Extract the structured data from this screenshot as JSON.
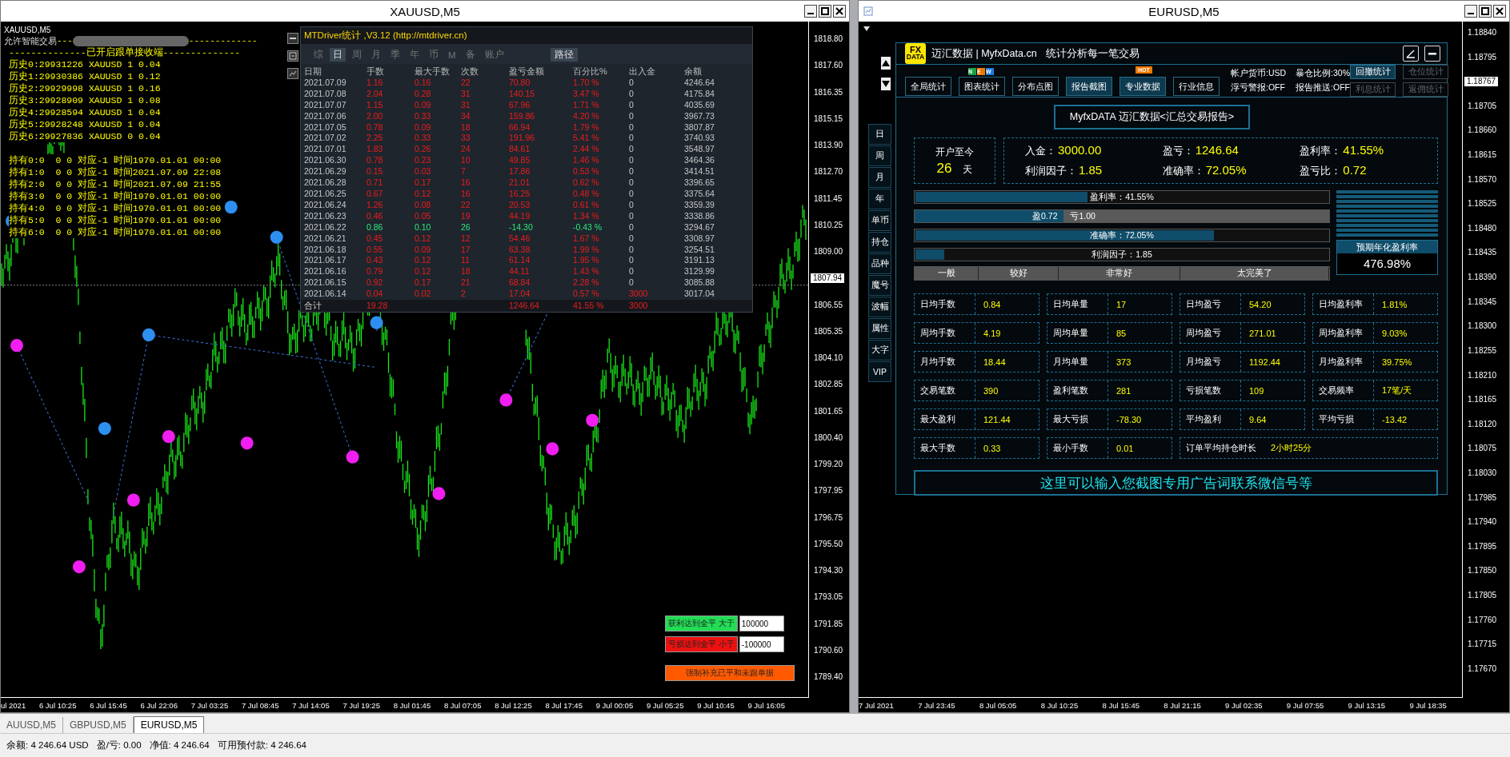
{
  "left_window": {
    "title": "XAUUSD,M5",
    "chart_label": "XAUUSD,M5",
    "ea_label": "允许智能交易",
    "ea_dashes_left": "---",
    "ea_dashes_right": "-------------",
    "header_line": "--------------已开启跟单接收端--------------",
    "history": [
      "历史0:29931226 XAUUSD 1 0.04",
      "历史1:29930386 XAUUSD 1 0.12",
      "历史2:29929998 XAUUSD 1 0.16",
      "历史3:29928909 XAUUSD 1 0.08",
      "历史4:29928594 XAUUSD 1 0.04",
      "历史5:29928248 XAUUSD 1 0.04",
      "历史6:29927836 XAUUSD 0 0.04"
    ],
    "holdings": [
      "持有0:0  0 0 对应-1 时间1970.01.01 00:00",
      "持有1:0  0 0 对应-1 时间2021.07.09 22:08",
      "持有2:0  0 0 对应-1 时间2021.07.09 21:55",
      "持有3:0  0 0 对应-1 时间1970.01.01 00:00",
      "持有4:0  0 0 对应-1 时间1970.01.01 00:00",
      "持有5:0  0 0 对应-1 时间1970.01.01 00:00",
      "持有6:0  0 0 对应-1 时间1970.01.01 00:00"
    ],
    "price_axis": [
      {
        "kind": "tick",
        "text": "1818.80"
      },
      {
        "kind": "tick",
        "text": "1817.60"
      },
      {
        "kind": "tick",
        "text": "1816.35"
      },
      {
        "kind": "tick",
        "text": "1815.15"
      },
      {
        "kind": "tick",
        "text": "1813.90"
      },
      {
        "kind": "tick",
        "text": "1812.70"
      },
      {
        "kind": "tick",
        "text": "1811.45"
      },
      {
        "kind": "tick",
        "text": "1810.25"
      },
      {
        "kind": "tick",
        "text": "1809.00"
      },
      {
        "kind": "current",
        "text": "1807.94"
      },
      {
        "kind": "tick",
        "text": "1806.55"
      },
      {
        "kind": "tick",
        "text": "1805.35"
      },
      {
        "kind": "tick",
        "text": "1804.10"
      },
      {
        "kind": "tick",
        "text": "1802.85"
      },
      {
        "kind": "tick",
        "text": "1801.65"
      },
      {
        "kind": "tick",
        "text": "1800.40"
      },
      {
        "kind": "tick",
        "text": "1799.20"
      },
      {
        "kind": "tick",
        "text": "1797.95"
      },
      {
        "kind": "tick",
        "text": "1796.75"
      },
      {
        "kind": "tick",
        "text": "1795.50"
      },
      {
        "kind": "tick",
        "text": "1794.30"
      },
      {
        "kind": "tick",
        "text": "1793.05"
      },
      {
        "kind": "tick",
        "text": "1791.85"
      },
      {
        "kind": "tick",
        "text": "1790.60"
      },
      {
        "kind": "tick",
        "text": "1789.40"
      }
    ],
    "time_axis": [
      "ul 2021",
      "6 Jul 10:25",
      "6 Jul 15:45",
      "6 Jul 22:06",
      "7 Jul 03:25",
      "7 Jul 08:45",
      "7 Jul 14:05",
      "7 Jul 19:25",
      "8 Jul 01:45",
      "8 Jul 07:05",
      "8 Jul 12:25",
      "8 Jul 17:45",
      "9 Jul 00:05",
      "9 Jul 05:25",
      "9 Jul 10:45",
      "9 Jul 16:05"
    ],
    "close_controls": [
      {
        "label": "获利达到全平 大于",
        "value": "100000",
        "color": "#22dd55"
      },
      {
        "label": "亏损达到全平 小于",
        "value": "-100000",
        "color": "#ee1111"
      }
    ],
    "force_button": "强制补充已平和未跟单据"
  },
  "stats_panel": {
    "title": "MTDriver统计 ,V3.12 (http://mtdriver.cn)",
    "tabs": [
      {
        "label": "综",
        "selected": false
      },
      {
        "label": "日",
        "selected": true
      },
      {
        "label": "周",
        "selected": false
      },
      {
        "label": "月",
        "selected": false
      },
      {
        "label": "季",
        "selected": false
      },
      {
        "label": "年",
        "selected": false
      },
      {
        "label": "币",
        "selected": false
      },
      {
        "label": "M",
        "selected": false
      },
      {
        "label": "备",
        "selected": false
      },
      {
        "label": "账户",
        "selected": false
      }
    ],
    "path_button": "路径",
    "columns": [
      "日期",
      "手数",
      "最大手数",
      "次数",
      "盈亏金额",
      "百分比%",
      "出入金",
      "余额"
    ],
    "rows": [
      {
        "cells": [
          "2021.07.09",
          "1.16",
          "0.16",
          "22",
          "70.80",
          "1.70 %",
          "0",
          "4246.64"
        ],
        "negative": false,
        "deposit": false
      },
      {
        "cells": [
          "2021.07.08",
          "2.04",
          "0.28",
          "31",
          "140.15",
          "3.47 %",
          "0",
          "4175.84"
        ],
        "negative": false,
        "deposit": false
      },
      {
        "cells": [
          "2021.07.07",
          "1.15",
          "0.09",
          "31",
          "67.96",
          "1.71 %",
          "0",
          "4035.69"
        ],
        "negative": false,
        "deposit": false
      },
      {
        "cells": [
          "2021.07.06",
          "2.00",
          "0.33",
          "34",
          "159.86",
          "4.20 %",
          "0",
          "3967.73"
        ],
        "negative": false,
        "deposit": false
      },
      {
        "cells": [
          "2021.07.05",
          "0.78",
          "0.09",
          "18",
          "66.94",
          "1.79 %",
          "0",
          "3807.87"
        ],
        "negative": false,
        "deposit": false
      },
      {
        "cells": [
          "2021.07.02",
          "2.25",
          "0.33",
          "33",
          "191.96",
          "5.41 %",
          "0",
          "3740.93"
        ],
        "negative": false,
        "deposit": false
      },
      {
        "cells": [
          "2021.07.01",
          "1.83",
          "0.26",
          "24",
          "84.61",
          "2.44 %",
          "0",
          "3548.97"
        ],
        "negative": false,
        "deposit": false
      },
      {
        "cells": [
          "2021.06.30",
          "0.78",
          "0.23",
          "10",
          "49.85",
          "1.46 %",
          "0",
          "3464.36"
        ],
        "negative": false,
        "deposit": false
      },
      {
        "cells": [
          "2021.06.29",
          "0.15",
          "0.03",
          "7",
          "17.86",
          "0.53 %",
          "0",
          "3414.51"
        ],
        "negative": false,
        "deposit": false
      },
      {
        "cells": [
          "2021.06.28",
          "0.71",
          "0.17",
          "16",
          "21.01",
          "0.62 %",
          "0",
          "3396.65"
        ],
        "negative": false,
        "deposit": false
      },
      {
        "cells": [
          "2021.06.25",
          "0.67",
          "0.12",
          "16",
          "16.25",
          "0.48 %",
          "0",
          "3375.64"
        ],
        "negative": false,
        "deposit": false
      },
      {
        "cells": [
          "2021.06.24",
          "1.26",
          "0.08",
          "22",
          "20.53",
          "0.61 %",
          "0",
          "3359.39"
        ],
        "negative": false,
        "deposit": false
      },
      {
        "cells": [
          "2021.06.23",
          "0.46",
          "0.05",
          "19",
          "44.19",
          "1.34 %",
          "0",
          "3338.86"
        ],
        "negative": false,
        "deposit": false
      },
      {
        "cells": [
          "2021.06.22",
          "0.86",
          "0.10",
          "26",
          "-14.30",
          "-0.43 %",
          "0",
          "3294.67"
        ],
        "negative": true,
        "deposit": false
      },
      {
        "cells": [
          "2021.06.21",
          "0.45",
          "0.12",
          "12",
          "54.46",
          "1.67 %",
          "0",
          "3308.97"
        ],
        "negative": false,
        "deposit": false
      },
      {
        "cells": [
          "2021.06.18",
          "0.55",
          "0.09",
          "17",
          "63.38",
          "1.99 %",
          "0",
          "3254.51"
        ],
        "negative": false,
        "deposit": false
      },
      {
        "cells": [
          "2021.06.17",
          "0.43",
          "0.12",
          "11",
          "61.14",
          "1.95 %",
          "0",
          "3191.13"
        ],
        "negative": false,
        "deposit": false
      },
      {
        "cells": [
          "2021.06.16",
          "0.79",
          "0.12",
          "18",
          "44.11",
          "1.43 %",
          "0",
          "3129.99"
        ],
        "negative": false,
        "deposit": false
      },
      {
        "cells": [
          "2021.06.15",
          "0.92",
          "0.17",
          "21",
          "68.84",
          "2.28 %",
          "0",
          "3085.88"
        ],
        "negative": false,
        "deposit": false
      },
      {
        "cells": [
          "2021.06.14",
          "0.04",
          "0.02",
          "2",
          "17.04",
          "0.57 %",
          "3000",
          "3017.04"
        ],
        "negative": false,
        "deposit": true
      }
    ],
    "total": {
      "label": "合计",
      "lots": "19.28",
      "profit": "1246.64",
      "percent": "41.55 %",
      "deposit": "3000"
    }
  },
  "right_window": {
    "title": "EURUSD,M5",
    "price_axis": [
      {
        "kind": "tick",
        "text": "1.18840"
      },
      {
        "kind": "tick",
        "text": "1.18795"
      },
      {
        "kind": "current",
        "text": "1.18767"
      },
      {
        "kind": "tick",
        "text": "1.18705"
      },
      {
        "kind": "tick",
        "text": "1.18660"
      },
      {
        "kind": "tick",
        "text": "1.18615"
      },
      {
        "kind": "tick",
        "text": "1.18570"
      },
      {
        "kind": "tick",
        "text": "1.18525"
      },
      {
        "kind": "tick",
        "text": "1.18480"
      },
      {
        "kind": "tick",
        "text": "1.18435"
      },
      {
        "kind": "tick",
        "text": "1.18390"
      },
      {
        "kind": "tick",
        "text": "1.18345"
      },
      {
        "kind": "tick",
        "text": "1.18300"
      },
      {
        "kind": "tick",
        "text": "1.18255"
      },
      {
        "kind": "tick",
        "text": "1.18210"
      },
      {
        "kind": "tick",
        "text": "1.18165"
      },
      {
        "kind": "tick",
        "text": "1.18120"
      },
      {
        "kind": "tick",
        "text": "1.18075"
      },
      {
        "kind": "tick",
        "text": "1.18030"
      },
      {
        "kind": "tick",
        "text": "1.17985"
      },
      {
        "kind": "tick",
        "text": "1.17940"
      },
      {
        "kind": "tick",
        "text": "1.17895"
      },
      {
        "kind": "tick",
        "text": "1.17850"
      },
      {
        "kind": "tick",
        "text": "1.17805"
      },
      {
        "kind": "tick",
        "text": "1.17760"
      },
      {
        "kind": "tick",
        "text": "1.17715"
      },
      {
        "kind": "tick",
        "text": "1.17670"
      }
    ],
    "time_axis": [
      "7 Jul 2021",
      "7 Jul 23:45",
      "8 Jul 05:05",
      "8 Jul 10:25",
      "8 Jul 15:45",
      "8 Jul 21:15",
      "9 Jul 02:35",
      "9 Jul 07:55",
      "9 Jul 13:15",
      "9 Jul 18:35"
    ],
    "side_buttons": [
      "日",
      "周",
      "月",
      "年",
      "单币",
      "持仓",
      "品种",
      "魔号",
      "波幅",
      "属性",
      "大字",
      "VIP"
    ]
  },
  "report_panel": {
    "logo": [
      "FX",
      "DATA"
    ],
    "brand": "迈汇数据 | MyfxData.cn",
    "slogan": "统计分析每一笔交易",
    "tabs": [
      {
        "label": "全局统计",
        "highlighted": false
      },
      {
        "label": "图表统计",
        "highlighted": false,
        "badge_letters": [
          "N",
          "E",
          "W"
        ]
      },
      {
        "label": "分布点图",
        "highlighted": false
      },
      {
        "label": "报告截图",
        "highlighted": true
      },
      {
        "label": "专业数据",
        "highlighted": true,
        "badge": "HOT"
      },
      {
        "label": "行业信息",
        "highlighted": false
      }
    ],
    "info": [
      "帐户货币:USD",
      "暴仓比例:30%",
      "浮亏警报:OFF",
      "报告推送:OFF"
    ],
    "side_tabs": [
      {
        "label": "回撤统计",
        "disabled": false
      },
      {
        "label": "仓位统计",
        "disabled": true
      },
      {
        "label": "利息统计",
        "disabled": true
      },
      {
        "label": "返佣统计",
        "disabled": true
      }
    ],
    "report_title": "MyfxDATA 迈汇数据<汇总交易报告>",
    "since": {
      "label": "开户至今",
      "days": "26",
      "unit": "天"
    },
    "summary": [
      {
        "label": "入金：",
        "value": "3000.00"
      },
      {
        "label": "盈亏：",
        "value": "1246.64"
      },
      {
        "label": "盈利率：",
        "value": "41.55%"
      },
      {
        "label": "利润因子：",
        "value": "1.85"
      },
      {
        "label": "准确率：",
        "value": "72.05%"
      },
      {
        "label": "盈亏比：",
        "value": "0.72"
      }
    ],
    "bars": [
      {
        "kind": "single",
        "label": "盈利率：41.55%",
        "level": 0.4155
      },
      {
        "kind": "split",
        "label": "盈0.72",
        "label2": "亏1.00",
        "level": 0.36
      },
      {
        "kind": "single",
        "label": "准确率：72.05%",
        "level": 0.7205
      },
      {
        "kind": "single",
        "label": "利润因子：1.85",
        "level": 0.07
      }
    ],
    "rating": [
      "一般",
      "较好",
      "非常好",
      "太完美了"
    ],
    "annual": {
      "label": "预期年化盈利率",
      "value": "476.98%"
    },
    "metrics": [
      {
        "label": "日均手数",
        "value": "0.84",
        "kind": "normal"
      },
      {
        "label": "日均单量",
        "value": "17",
        "kind": "normal"
      },
      {
        "label": "日均盈亏",
        "value": "54.20",
        "kind": "normal"
      },
      {
        "label": "日均盈利率",
        "value": "1.81%",
        "kind": "normal"
      },
      {
        "label": "周均手数",
        "value": "4.19",
        "kind": "normal"
      },
      {
        "label": "周均单量",
        "value": "85",
        "kind": "normal"
      },
      {
        "label": "周均盈亏",
        "value": "271.01",
        "kind": "normal"
      },
      {
        "label": "周均盈利率",
        "value": "9.03%",
        "kind": "normal"
      },
      {
        "label": "月均手数",
        "value": "18.44",
        "kind": "normal"
      },
      {
        "label": "月均单量",
        "value": "373",
        "kind": "normal"
      },
      {
        "label": "月均盈亏",
        "value": "1192.44",
        "kind": "normal"
      },
      {
        "label": "月均盈利率",
        "value": "39.75%",
        "kind": "normal"
      },
      {
        "label": "交易笔数",
        "value": "390",
        "kind": "normal"
      },
      {
        "label": "盈利笔数",
        "value": "281",
        "kind": "normal"
      },
      {
        "label": "亏损笔数",
        "value": "109",
        "kind": "normal"
      },
      {
        "label": "交易频率",
        "value": "17笔/天",
        "kind": "normal"
      },
      {
        "label": "最大盈利",
        "value": "121.44",
        "kind": "normal"
      },
      {
        "label": "最大亏损",
        "value": "-78.30",
        "kind": "normal"
      },
      {
        "label": "平均盈利",
        "value": "9.64",
        "kind": "normal"
      },
      {
        "label": "平均亏损",
        "value": "-13.42",
        "kind": "normal"
      },
      {
        "label": "最大手数",
        "value": "0.33",
        "kind": "normal"
      },
      {
        "label": "最小手数",
        "value": "0.01",
        "kind": "normal"
      },
      {
        "label": "订单平均持仓时长",
        "value": "2小时25分",
        "kind": "wide"
      }
    ],
    "ad": "这里可以输入您截图专用广告词联系微信号等"
  },
  "chart_tabs": [
    {
      "label": "AUUSD,M5",
      "selected": false
    },
    {
      "label": "GBPUSD,M5",
      "selected": false
    },
    {
      "label": "EURUSD,M5",
      "selected": true
    }
  ],
  "status_bar": [
    "余额: 4 246.64 USD",
    "盈/亏: 0.00",
    "净值: 4 246.64",
    "可用预付款: 4 246.64"
  ]
}
